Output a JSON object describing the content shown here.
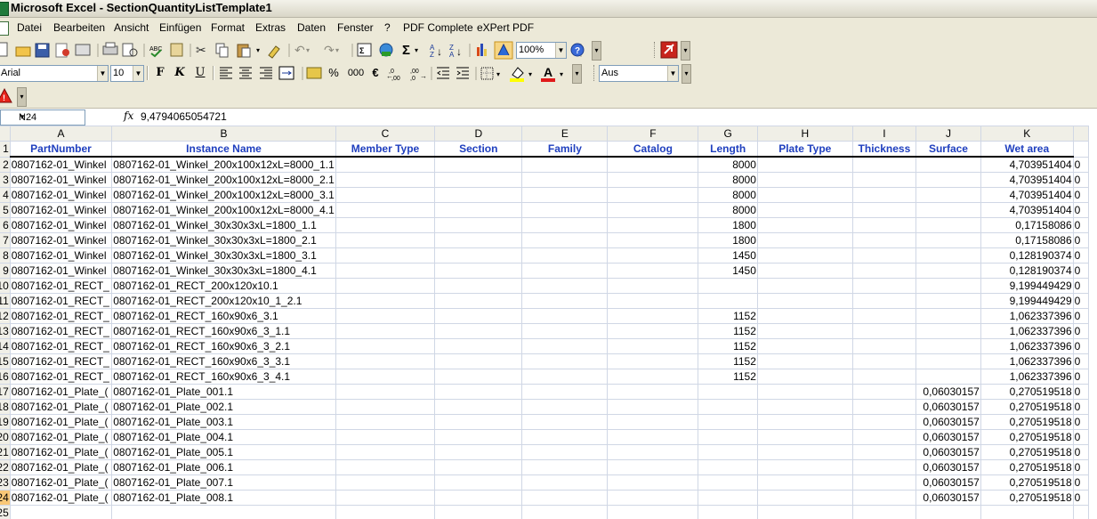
{
  "window": {
    "title": "Microsoft Excel - SectionQuantityListTemplate1"
  },
  "menu": [
    "Datei",
    "Bearbeiten",
    "Ansicht",
    "Einfügen",
    "Format",
    "Extras",
    "Daten",
    "Fenster",
    "?",
    "PDF Complete",
    "eXPert PDF"
  ],
  "toolbar": {
    "zoom": "100%"
  },
  "format_toolbar": {
    "font": "Arial",
    "size": "10",
    "bold": "F",
    "italic": "K",
    "underline": "U",
    "percent": "%",
    "thousands": "000",
    "euro": "€"
  },
  "extra_toolbar": {
    "select": "Aus"
  },
  "formula_bar": {
    "name_box": "N24",
    "fx": "fx",
    "value": "9,4794065054721"
  },
  "sheet": {
    "col_letters": [
      "",
      "A",
      "B",
      "C",
      "D",
      "E",
      "F",
      "G",
      "H",
      "I",
      "J",
      "K",
      ""
    ],
    "headers": [
      "PartNumber",
      "Instance Name",
      "Member Type",
      "Section",
      "Family",
      "Catalog",
      "Length",
      "Plate Type",
      "Thickness",
      "Surface",
      "Wet area"
    ],
    "rows": [
      {
        "n": "2",
        "a": "0807162-01_Winkel",
        "b": "0807162-01_Winkel_200x100x12xL=8000_1.1",
        "g": "8000",
        "j": "",
        "k": "4,703951404",
        "l": "0"
      },
      {
        "n": "3",
        "a": "0807162-01_Winkel",
        "b": "0807162-01_Winkel_200x100x12xL=8000_2.1",
        "g": "8000",
        "j": "",
        "k": "4,703951404",
        "l": "0"
      },
      {
        "n": "4",
        "a": "0807162-01_Winkel",
        "b": "0807162-01_Winkel_200x100x12xL=8000_3.1",
        "g": "8000",
        "j": "",
        "k": "4,703951404",
        "l": "0"
      },
      {
        "n": "5",
        "a": "0807162-01_Winkel",
        "b": "0807162-01_Winkel_200x100x12xL=8000_4.1",
        "g": "8000",
        "j": "",
        "k": "4,703951404",
        "l": "0"
      },
      {
        "n": "6",
        "a": "0807162-01_Winkel",
        "b": "0807162-01_Winkel_30x30x3xL=1800_1.1",
        "g": "1800",
        "j": "",
        "k": "0,17158086",
        "l": "0"
      },
      {
        "n": "7",
        "a": "0807162-01_Winkel",
        "b": "0807162-01_Winkel_30x30x3xL=1800_2.1",
        "g": "1800",
        "j": "",
        "k": "0,17158086",
        "l": "0"
      },
      {
        "n": "8",
        "a": "0807162-01_Winkel",
        "b": "0807162-01_Winkel_30x30x3xL=1800_3.1",
        "g": "1450",
        "j": "",
        "k": "0,128190374",
        "l": "0"
      },
      {
        "n": "9",
        "a": "0807162-01_Winkel",
        "b": "0807162-01_Winkel_30x30x3xL=1800_4.1",
        "g": "1450",
        "j": "",
        "k": "0,128190374",
        "l": "0"
      },
      {
        "n": "10",
        "a": "0807162-01_RECT_",
        "b": "0807162-01_RECT_200x120x10.1",
        "g": "",
        "j": "",
        "k": "9,199449429",
        "l": "0"
      },
      {
        "n": "11",
        "a": "0807162-01_RECT_",
        "b": "0807162-01_RECT_200x120x10_1_2.1",
        "g": "",
        "j": "",
        "k": "9,199449429",
        "l": "0"
      },
      {
        "n": "12",
        "a": "0807162-01_RECT_",
        "b": "0807162-01_RECT_160x90x6_3.1",
        "g": "1152",
        "j": "",
        "k": "1,062337396",
        "l": "0"
      },
      {
        "n": "13",
        "a": "0807162-01_RECT_",
        "b": "0807162-01_RECT_160x90x6_3_1.1",
        "g": "1152",
        "j": "",
        "k": "1,062337396",
        "l": "0"
      },
      {
        "n": "14",
        "a": "0807162-01_RECT_",
        "b": "0807162-01_RECT_160x90x6_3_2.1",
        "g": "1152",
        "j": "",
        "k": "1,062337396",
        "l": "0"
      },
      {
        "n": "15",
        "a": "0807162-01_RECT_",
        "b": "0807162-01_RECT_160x90x6_3_3.1",
        "g": "1152",
        "j": "",
        "k": "1,062337396",
        "l": "0"
      },
      {
        "n": "16",
        "a": "0807162-01_RECT_",
        "b": "0807162-01_RECT_160x90x6_3_4.1",
        "g": "1152",
        "j": "",
        "k": "1,062337396",
        "l": "0"
      },
      {
        "n": "17",
        "a": "0807162-01_Plate_(",
        "b": "0807162-01_Plate_001.1",
        "g": "",
        "j": "0,06030157",
        "k": "0,270519518",
        "l": "0"
      },
      {
        "n": "18",
        "a": "0807162-01_Plate_(",
        "b": "0807162-01_Plate_002.1",
        "g": "",
        "j": "0,06030157",
        "k": "0,270519518",
        "l": "0"
      },
      {
        "n": "19",
        "a": "0807162-01_Plate_(",
        "b": "0807162-01_Plate_003.1",
        "g": "",
        "j": "0,06030157",
        "k": "0,270519518",
        "l": "0"
      },
      {
        "n": "20",
        "a": "0807162-01_Plate_(",
        "b": "0807162-01_Plate_004.1",
        "g": "",
        "j": "0,06030157",
        "k": "0,270519518",
        "l": "0"
      },
      {
        "n": "21",
        "a": "0807162-01_Plate_(",
        "b": "0807162-01_Plate_005.1",
        "g": "",
        "j": "0,06030157",
        "k": "0,270519518",
        "l": "0"
      },
      {
        "n": "22",
        "a": "0807162-01_Plate_(",
        "b": "0807162-01_Plate_006.1",
        "g": "",
        "j": "0,06030157",
        "k": "0,270519518",
        "l": "0"
      },
      {
        "n": "23",
        "a": "0807162-01_Plate_(",
        "b": "0807162-01_Plate_007.1",
        "g": "",
        "j": "0,06030157",
        "k": "0,270519518",
        "l": "0"
      },
      {
        "n": "24",
        "a": "0807162-01_Plate_(",
        "b": "0807162-01_Plate_008.1",
        "g": "",
        "j": "0,06030157",
        "k": "0,270519518",
        "l": "0"
      },
      {
        "n": "25",
        "a": "",
        "b": "",
        "g": "",
        "j": "",
        "k": "",
        "l": ""
      }
    ],
    "active_row": "24",
    "header_row_number": "1",
    "colors": {
      "header_text": "#1f3fbf",
      "active_row_header": "#f9c878"
    }
  }
}
